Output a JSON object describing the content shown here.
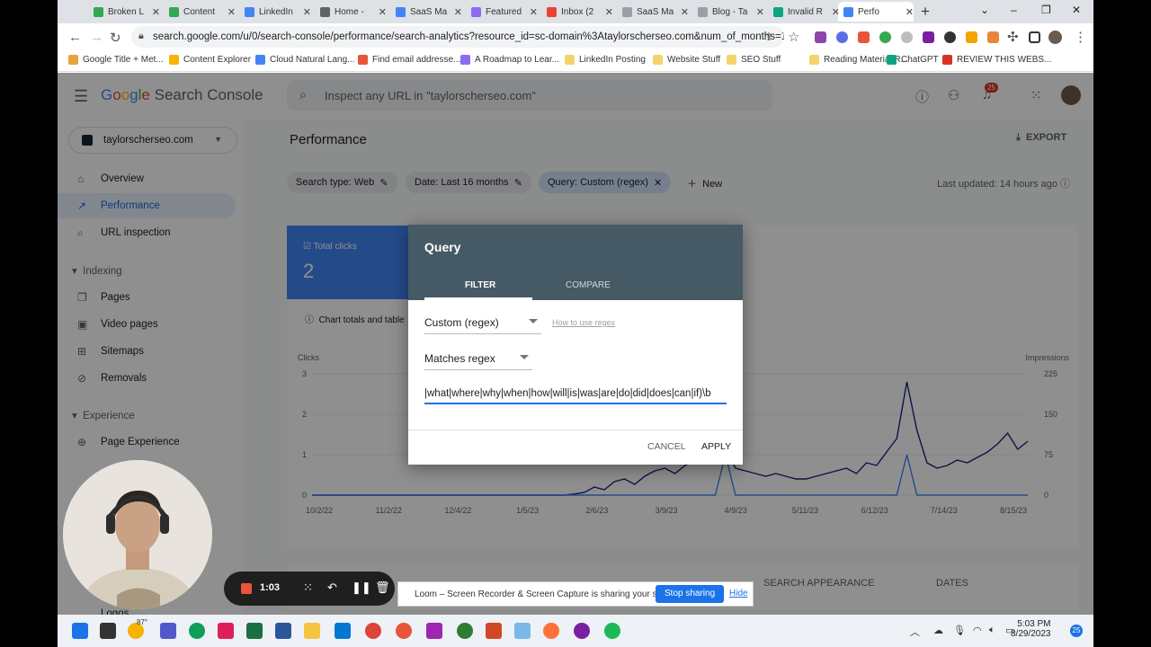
{
  "browser": {
    "tabs": [
      {
        "label": "Broken L",
        "color": "#34a853"
      },
      {
        "label": "Content",
        "color": "#34a853"
      },
      {
        "label": "LinkedIn",
        "color": "#4285f4"
      },
      {
        "label": "Home - ",
        "color": "#5f6368"
      },
      {
        "label": "SaaS Ma",
        "color": "#4285f4"
      },
      {
        "label": "Featured",
        "color": "#8e6cef"
      },
      {
        "label": "Inbox (2",
        "color": "#ea4335"
      },
      {
        "label": "SaaS Ma",
        "color": "#9aa0a6"
      },
      {
        "label": "Blog - Ta",
        "color": "#9aa0a6"
      },
      {
        "label": "Invalid R",
        "color": "#10a37f"
      },
      {
        "label": "Perfo",
        "color": "#4285f4"
      }
    ],
    "url": "search.google.com/u/0/search-console/performance/search-analytics?resource_id=sc-domain%3Ataylorscherseo.com&num_of_months=16&q...",
    "bookmarks": [
      {
        "label": "Google Title + Met...",
        "color": "#e8a33d"
      },
      {
        "label": "Content Explorer",
        "color": "#f4b400"
      },
      {
        "label": "Cloud Natural Lang...",
        "color": "#4285f4"
      },
      {
        "label": "Find email addresse...",
        "color": "#e8553a"
      },
      {
        "label": "A Roadmap to Lear...",
        "color": "#8e6cef"
      },
      {
        "label": "LinkedIn Posting",
        "color": "#f4d36b"
      },
      {
        "label": "Website Stuff",
        "color": "#f4d36b"
      },
      {
        "label": "SEO Stuff",
        "color": "#f4d36b"
      },
      {
        "label": "Reading Material R...",
        "color": "#f4d36b"
      },
      {
        "label": "ChatGPT",
        "color": "#10a37f"
      },
      {
        "label": "REVIEW THIS WEBS...",
        "color": "#d93025"
      }
    ]
  },
  "gsc": {
    "app_name": "Search Console",
    "search_placeholder": "Inspect any URL in \"taylorscherseo.com\"",
    "notification_count": "25",
    "property": "taylorscherseo.com",
    "nav": {
      "overview": "Overview",
      "performance": "Performance",
      "url_inspection": "URL inspection",
      "indexing": "Indexing",
      "pages": "Pages",
      "video_pages": "Video pages",
      "sitemaps": "Sitemaps",
      "removals": "Removals",
      "experience": "Experience",
      "page_experience": "Page Experience",
      "logos": "Logos"
    },
    "page_title": "Performance",
    "export_label": "EXPORT",
    "chips": {
      "search_type": "Search type: Web",
      "date": "Date: Last 16 months",
      "query": "Query: Custom (regex)",
      "new": "New"
    },
    "last_updated": "Last updated: 14 hours ago",
    "total_clicks_label": "Total clicks",
    "total_clicks_value": "2",
    "totals_note": "Chart totals and table",
    "bottom_tabs": {
      "search_appearance": "SEARCH APPEARANCE",
      "dates": "DATES"
    }
  },
  "chart_data": {
    "type": "line",
    "ylabel_left": "Clicks",
    "ylabel_right": "Impressions",
    "left_ticks": [
      "3",
      "2",
      "1",
      "0"
    ],
    "right_ticks": [
      "225",
      "150",
      "75",
      "0"
    ],
    "x_ticks": [
      "10/2/22",
      "11/2/22",
      "12/4/22",
      "1/5/23",
      "2/6/23",
      "3/9/23",
      "4/9/23",
      "5/11/23",
      "6/12/23",
      "7/14/23",
      "8/15/23"
    ],
    "series": [
      {
        "name": "Clicks",
        "color": "#4285f4",
        "values": [
          0,
          0,
          0,
          0,
          0,
          0,
          0,
          0,
          0,
          0,
          0,
          0,
          0,
          0,
          0,
          0,
          0,
          0,
          0,
          0,
          0,
          0,
          0,
          0,
          0,
          0,
          0,
          0,
          0,
          0,
          0,
          0,
          0,
          0,
          0,
          0,
          0,
          0,
          0,
          0,
          0,
          1,
          0,
          0,
          0,
          0,
          0,
          0,
          0,
          0,
          0,
          0,
          0,
          0,
          0,
          0,
          0,
          0,
          0,
          1,
          0,
          0,
          0,
          0,
          0,
          0,
          0,
          0,
          0,
          0,
          0,
          0
        ]
      },
      {
        "name": "Impressions",
        "color": "#1a237e",
        "values": [
          0,
          0,
          0,
          0,
          0,
          0,
          0,
          0,
          0,
          0,
          0,
          0,
          0,
          0,
          0,
          0,
          0,
          0,
          0,
          0,
          0,
          0,
          0,
          0,
          0,
          0,
          2,
          5,
          15,
          10,
          25,
          30,
          20,
          35,
          45,
          50,
          40,
          55,
          65,
          75,
          60,
          90,
          50,
          45,
          40,
          35,
          40,
          35,
          30,
          30,
          35,
          40,
          45,
          50,
          40,
          60,
          55,
          80,
          105,
          210,
          120,
          60,
          50,
          55,
          65,
          60,
          70,
          80,
          95,
          115,
          85,
          100
        ]
      }
    ]
  },
  "dialog": {
    "title": "Query",
    "tab_filter": "FILTER",
    "tab_compare": "COMPARE",
    "filter_type": "Custom (regex)",
    "how_to": "How to use regex",
    "match_mode": "Matches regex",
    "regex_value": "|what|where|why|when|how|will|is|was|are|do|did|does|can|if)\\b",
    "cancel": "CANCEL",
    "apply": "APPLY"
  },
  "recorder": {
    "time": "1:03"
  },
  "share_notice": {
    "text": "Loom – Screen Recorder & Screen Capture is sharing your screen.",
    "stop": "Stop sharing",
    "hide": "Hide"
  },
  "taskbar": {
    "time": "5:03 PM",
    "date": "8/29/2023",
    "notif": "25",
    "temp": "87°"
  }
}
